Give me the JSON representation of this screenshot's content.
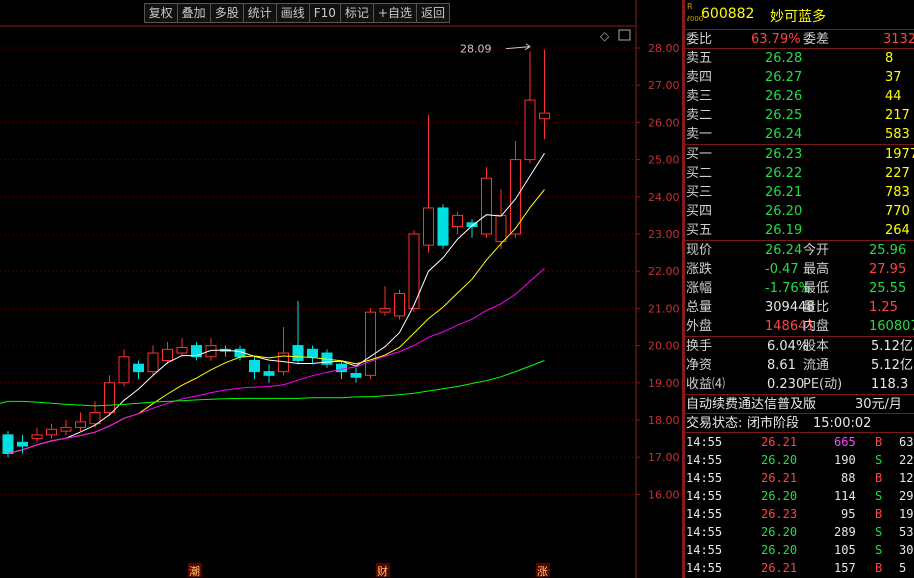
{
  "toolbar": {
    "buttons": [
      "复权",
      "叠加",
      "多股",
      "统计",
      "画线",
      "F10",
      "标记",
      "+自选",
      "返回"
    ]
  },
  "chart": {
    "peak_label": "28.09",
    "y_ticks": [
      "28.00",
      "27.00",
      "26.00",
      "25.00",
      "24.00",
      "23.00",
      "22.00",
      "21.00",
      "20.00",
      "19.00",
      "18.00",
      "17.00",
      "16.00"
    ],
    "markers": [
      "潮",
      "财",
      "涨"
    ],
    "corner_icons": [
      "◇",
      "▭"
    ],
    "colors": {
      "up": "#ff3030",
      "down": "#00e0e0",
      "ma5": "#ffffff",
      "ma10": "#ffff00",
      "ma20": "#ff00ff",
      "ma60": "#00ff00",
      "grid": "#6a0000"
    }
  },
  "quote": {
    "ric_top": "R",
    "ric_bottom": "ℓ000",
    "code": "600882",
    "name": "妙可蓝多",
    "weibi_label": "委比",
    "weibi_value": "63.79%",
    "weicha_label": "委差",
    "weicha_value": "3132",
    "asks": [
      {
        "label": "卖五",
        "price": "26.28",
        "vol": "8"
      },
      {
        "label": "卖四",
        "price": "26.27",
        "vol": "37"
      },
      {
        "label": "卖三",
        "price": "26.26",
        "vol": "44"
      },
      {
        "label": "卖二",
        "price": "26.25",
        "vol": "217"
      },
      {
        "label": "卖一",
        "price": "26.24",
        "vol": "583"
      }
    ],
    "bids": [
      {
        "label": "买一",
        "price": "26.23",
        "vol": "1977"
      },
      {
        "label": "买二",
        "price": "26.22",
        "vol": "227"
      },
      {
        "label": "买三",
        "price": "26.21",
        "vol": "783"
      },
      {
        "label": "买四",
        "price": "26.20",
        "vol": "770"
      },
      {
        "label": "买五",
        "price": "26.19",
        "vol": "264"
      }
    ],
    "stats": [
      {
        "l1": "现价",
        "v1": "26.24",
        "c1": "c-green",
        "l2": "今开",
        "v2": "25.96",
        "c2": "c-green"
      },
      {
        "l1": "涨跌",
        "v1": "-0.47",
        "c1": "c-green",
        "l2": "最高",
        "v2": "27.95",
        "c2": "c-red"
      },
      {
        "l1": "涨幅",
        "v1": "-1.76%",
        "c1": "c-green",
        "l2": "最低",
        "v2": "25.55",
        "c2": "c-green"
      },
      {
        "l1": "总量",
        "v1": "309448",
        "c1": "c-white",
        "l2": "量比",
        "v2": "1.25",
        "c2": "c-red"
      },
      {
        "l1": "外盘",
        "v1": "148641",
        "c1": "c-red",
        "l2": "内盘",
        "v2": "160807",
        "c2": "c-green"
      }
    ],
    "stats2": [
      {
        "l1": "换手",
        "v1": "6.04%",
        "l2": "股本",
        "v2": "5.12亿"
      },
      {
        "l1": "净资",
        "v1": "8.61",
        "l2": "流通",
        "v2": "5.12亿"
      },
      {
        "l1": "收益⑷",
        "v1": "0.230",
        "l2": "PE(动)",
        "v2": "118.3"
      }
    ],
    "promo": "自动续费通达信普及版",
    "promo_price": "30元/月",
    "status_label": "交易状态:",
    "status_value": "闭市阶段",
    "status_time": "15:00:02",
    "ticks": [
      {
        "t": "14:55",
        "p": "26.21",
        "pc": "c-red",
        "v": "665",
        "vc": "c-mag",
        "bs": "B",
        "bc": "c-red",
        "n": "63"
      },
      {
        "t": "14:55",
        "p": "26.20",
        "pc": "c-green",
        "v": "190",
        "vc": "c-white",
        "bs": "S",
        "bc": "c-green",
        "n": "22"
      },
      {
        "t": "14:55",
        "p": "26.21",
        "pc": "c-red",
        "v": "88",
        "vc": "c-white",
        "bs": "B",
        "bc": "c-red",
        "n": "12"
      },
      {
        "t": "14:55",
        "p": "26.20",
        "pc": "c-green",
        "v": "114",
        "vc": "c-white",
        "bs": "S",
        "bc": "c-green",
        "n": "29"
      },
      {
        "t": "14:55",
        "p": "26.23",
        "pc": "c-red",
        "v": "95",
        "vc": "c-white",
        "bs": "B",
        "bc": "c-red",
        "n": "19"
      },
      {
        "t": "14:55",
        "p": "26.20",
        "pc": "c-green",
        "v": "289",
        "vc": "c-white",
        "bs": "S",
        "bc": "c-green",
        "n": "53"
      },
      {
        "t": "14:55",
        "p": "26.20",
        "pc": "c-green",
        "v": "105",
        "vc": "c-white",
        "bs": "S",
        "bc": "c-green",
        "n": "30"
      },
      {
        "t": "14:55",
        "p": "26.21",
        "pc": "c-red",
        "v": "157",
        "vc": "c-white",
        "bs": "B",
        "bc": "c-red",
        "n": "5"
      }
    ]
  }
}
